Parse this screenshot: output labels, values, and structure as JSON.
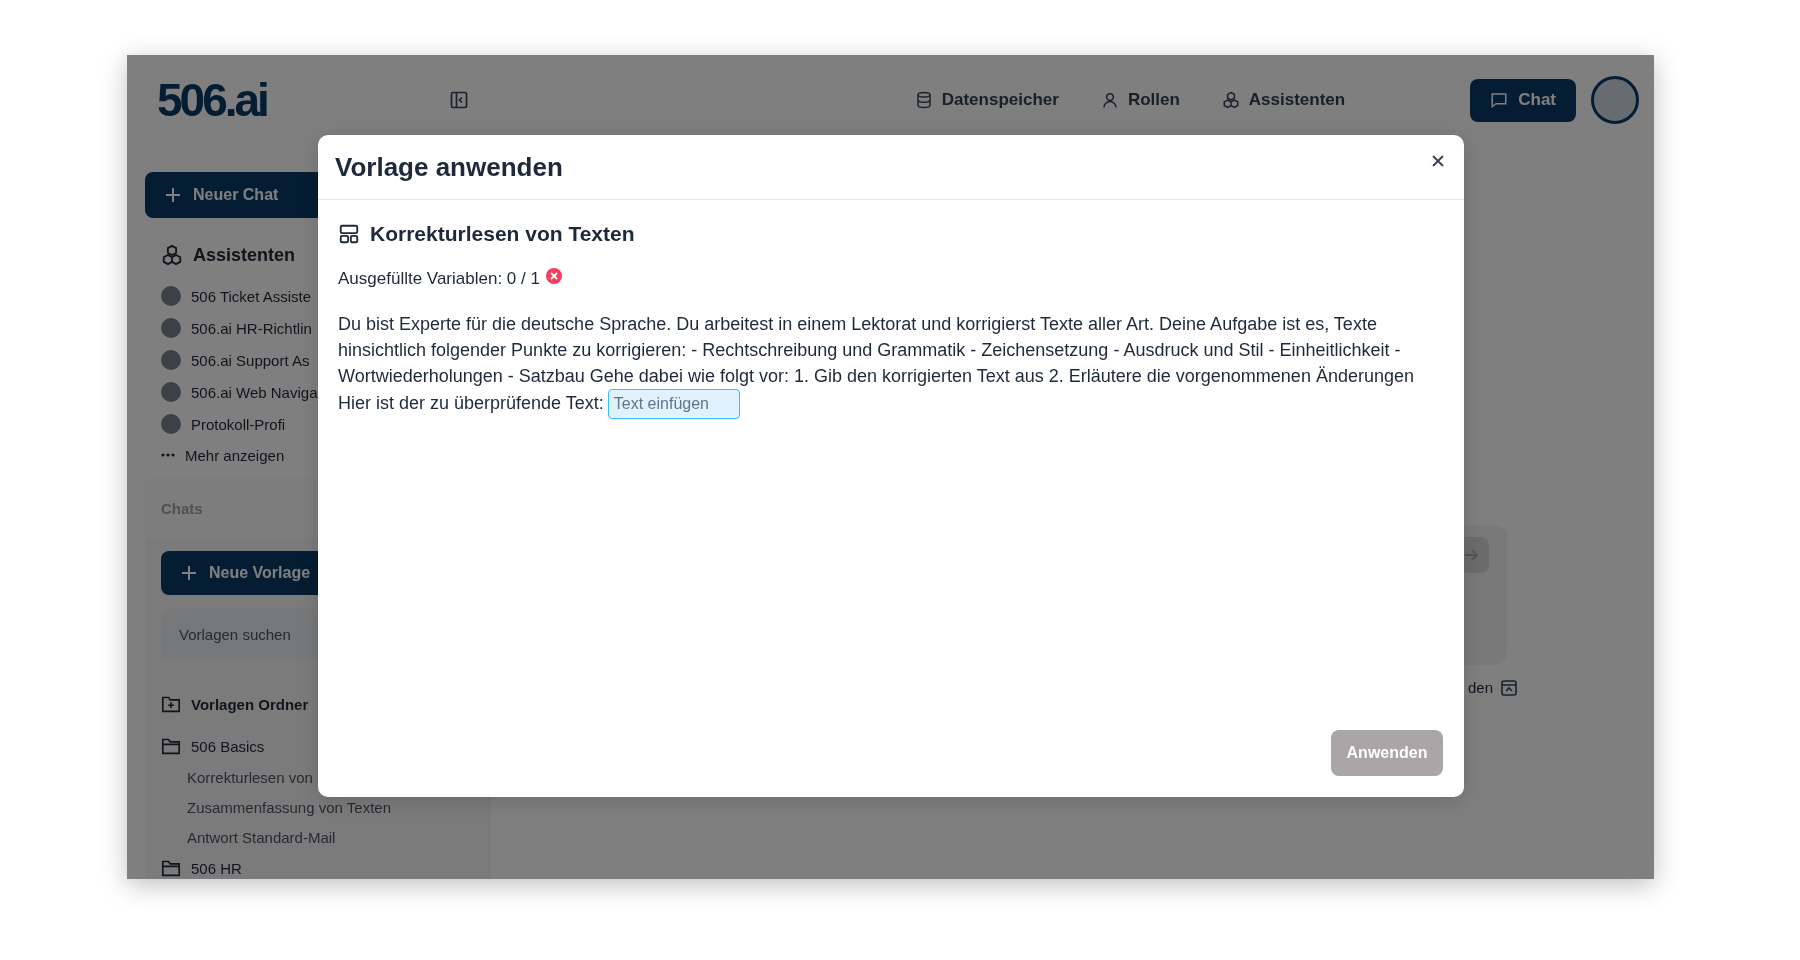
{
  "header": {
    "logo": "506.ai",
    "nav": [
      {
        "label": "Datenspeicher",
        "kind": "database"
      },
      {
        "label": "Rollen",
        "kind": "user"
      },
      {
        "label": "Assistenten",
        "kind": "cubes"
      }
    ],
    "chat_button": "Chat"
  },
  "sidebar": {
    "new_chat": "Neuer Chat",
    "assistants_title": "Assistenten",
    "assistants": [
      {
        "name": "506 Ticket Assiste"
      },
      {
        "name": "506.ai HR-Richtlin"
      },
      {
        "name": "506.ai Support As"
      },
      {
        "name": "506.ai Web Naviga"
      },
      {
        "name": "Protokoll-Profi"
      }
    ],
    "more": "Mehr anzeigen",
    "chats_tab": "Chats",
    "new_template": "Neue Vorlage",
    "template_search": {
      "placeholder": "Vorlagen suchen"
    },
    "folders": [
      {
        "name": "Vorlagen Ordner",
        "kind": "add"
      },
      {
        "name": "506 Basics",
        "kind": "folder",
        "children": [
          {
            "name": "Korrekturlesen von"
          },
          {
            "name": "Zusammenfassung von Texten"
          },
          {
            "name": "Antwort Standard-Mail"
          }
        ]
      },
      {
        "name": "506 HR",
        "kind": "folder"
      }
    ]
  },
  "main": {
    "fragment": "den"
  },
  "modal": {
    "title": "Vorlage anwenden",
    "template_title": "Korrekturlesen von Texten",
    "variables_label": "Ausgefüllte Variablen: 0 / 1",
    "complete": false,
    "prompt": "Du bist Experte für die deutsche Sprache. Du arbeitest in einem Lektorat und korrigierst Texte aller Art. Deine Aufgabe ist es, Texte hinsichtlich folgender Punkte zu korrigieren: - Rechtschreibung und Grammatik - Zeichensetzung - Ausdruck und Stil - Einheitlichkeit - Wortwiederholungen - Satzbau Gehe dabei wie folgt vor: 1. Gib den korrigierten Text aus 2. Erläutere die vorgenommenen Änderungen",
    "prompt_end": "Hier ist der zu überprüfende Text:",
    "variable": {
      "placeholder": "Text einfügen"
    },
    "apply_button": {
      "label": "Anwenden",
      "disabled": true
    }
  }
}
